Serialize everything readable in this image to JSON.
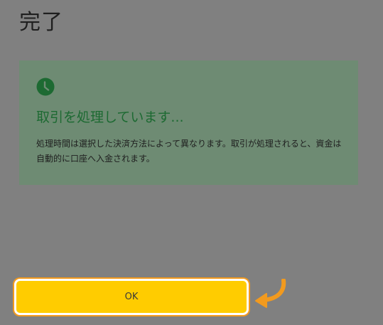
{
  "page": {
    "title": "完了"
  },
  "status_card": {
    "icon": "clock-icon",
    "heading": "取引を処理しています...",
    "message": "処理時間は選択した決済方法によって異なります。取引が処理されると、資金は自動的に口座へ入金されます。"
  },
  "ok_button": {
    "label": "OK",
    "pointer_icon": "curved-arrow-icon"
  },
  "colors": {
    "background": "#808080",
    "card_background": "#6e8b73",
    "accent_green": "#1d6a32",
    "button_yellow": "#ffcc00",
    "highlight_orange": "#f29a1e"
  }
}
